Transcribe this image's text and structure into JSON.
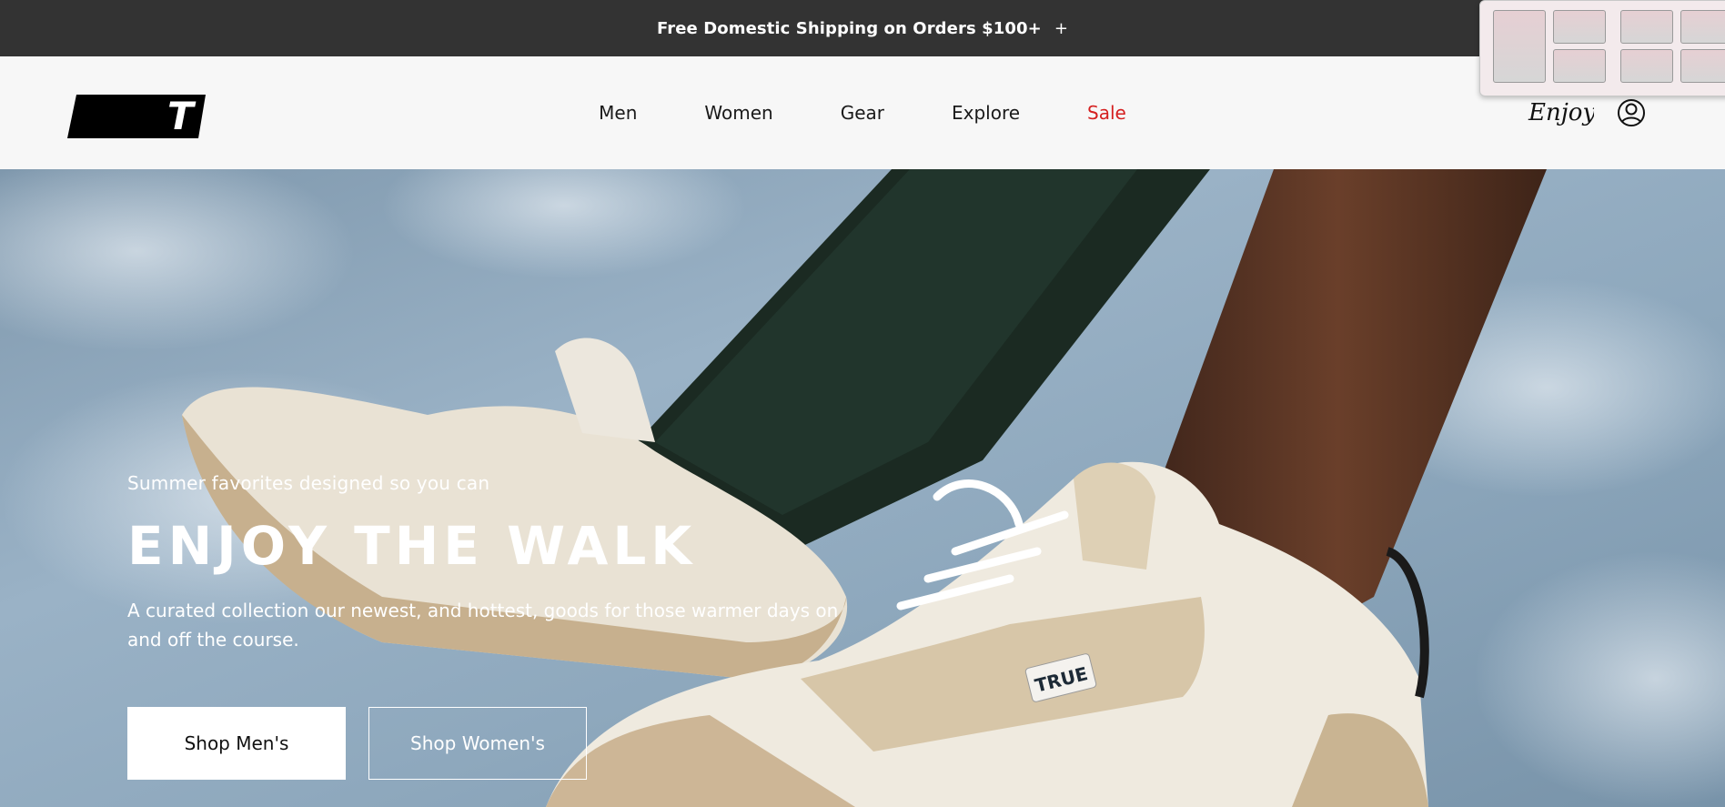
{
  "announcement": {
    "text": "Free Domestic Shipping on Orders $100+",
    "expand_symbol": "+"
  },
  "header": {
    "logo_letter": "T",
    "nav": [
      {
        "label": "Men"
      },
      {
        "label": "Women"
      },
      {
        "label": "Gear"
      },
      {
        "label": "Explore"
      },
      {
        "label": "Sale"
      }
    ],
    "enjoy_logo_text": "Enjoy",
    "account_icon": "account-icon"
  },
  "hero": {
    "eyebrow": "Summer favorites designed so you can",
    "headline": "ENJOY THE WALK",
    "body": "A curated collection our newest, and hottest, goods for those warmer days on and off the course.",
    "shoe_tag_text": "TRUE",
    "buttons": {
      "primary": "Shop Men's",
      "secondary": "Shop Women's"
    }
  },
  "colors": {
    "announcement_bg": "#333333",
    "header_bg": "#f7f7f7",
    "sale": "#d51f1f",
    "sky": "#8ea8bd"
  }
}
